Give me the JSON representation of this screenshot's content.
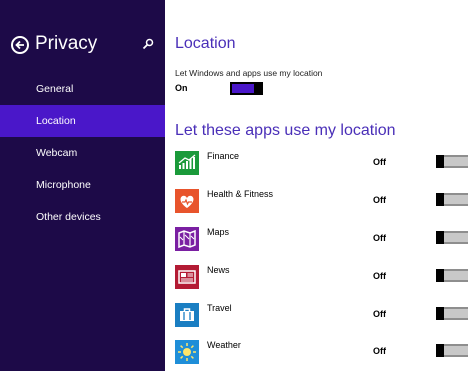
{
  "sidebar": {
    "title": "Privacy",
    "items": [
      {
        "label": "General"
      },
      {
        "label": "Location"
      },
      {
        "label": "Webcam"
      },
      {
        "label": "Microphone"
      },
      {
        "label": "Other devices"
      }
    ],
    "active_index": 1
  },
  "location": {
    "heading": "Location",
    "description": "Let Windows and apps use my location",
    "state": "On"
  },
  "apps_section": {
    "heading": "Let these apps use my location",
    "apps": [
      {
        "name": "Finance",
        "state": "Off",
        "icon": "finance-icon",
        "color": "#1a9a3a"
      },
      {
        "name": "Health & Fitness",
        "state": "Off",
        "icon": "health-fitness-icon",
        "color": "#e8542c"
      },
      {
        "name": "Maps",
        "state": "Off",
        "icon": "maps-icon",
        "color": "#7a1fa2"
      },
      {
        "name": "News",
        "state": "Off",
        "icon": "news-icon",
        "color": "#b31b34"
      },
      {
        "name": "Travel",
        "state": "Off",
        "icon": "travel-icon",
        "color": "#1a7ec2"
      },
      {
        "name": "Weather",
        "state": "Off",
        "icon": "weather-icon",
        "color": "#1f8ed8"
      }
    ]
  },
  "colors": {
    "sidebar_bg": "#1d0a48",
    "accent": "#4a17c9",
    "heading": "#4a2fb8"
  }
}
